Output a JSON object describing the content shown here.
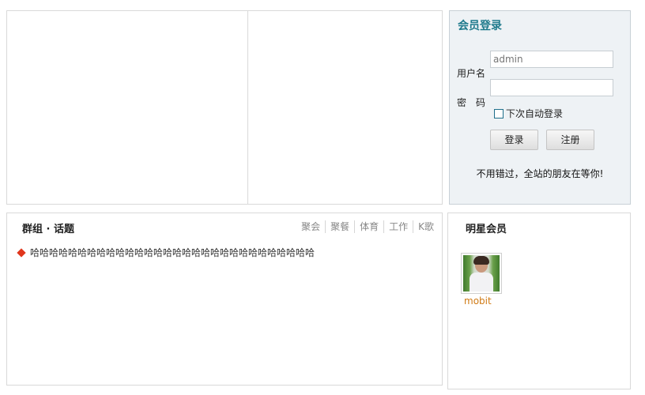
{
  "login": {
    "title": "会员登录",
    "username_label": "用户名",
    "username_placeholder": "admin",
    "password_label": "密　码",
    "remember_label": "下次自动登录",
    "login_button": "登录",
    "register_button": "注册",
    "note": "不用错过，全站的朋友在等你!"
  },
  "group": {
    "title": "群组 · 话题",
    "tags": [
      "聚会",
      "聚餐",
      "体育",
      "工作",
      "K歌"
    ],
    "topics": [
      "哈哈哈哈哈哈哈哈哈哈哈哈哈哈哈哈哈哈哈哈哈哈哈哈哈哈哈哈哈哈"
    ]
  },
  "stars": {
    "title": "明星会员",
    "members": [
      {
        "name": "mobit"
      }
    ]
  },
  "colors": {
    "login_title": "#1f7a8c",
    "member_name": "#d07a14",
    "bullet": "#e0361c"
  }
}
